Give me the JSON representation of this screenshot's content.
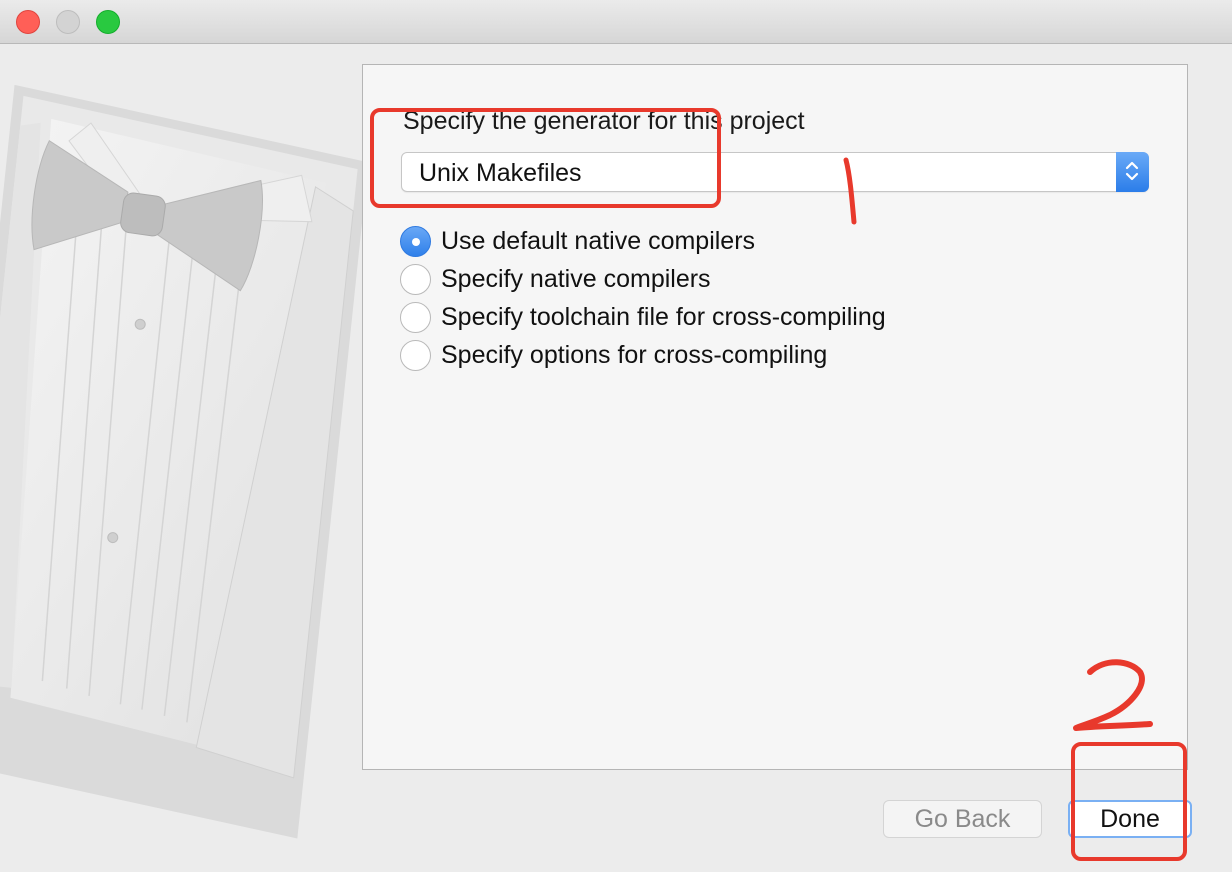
{
  "window": {
    "traffic_lights": [
      "close",
      "minimize",
      "zoom"
    ]
  },
  "generator": {
    "label": "Specify the generator for this project",
    "selected": "Unix Makefiles"
  },
  "compiler_options": [
    {
      "label": "Use default native compilers",
      "selected": true
    },
    {
      "label": "Specify native compilers",
      "selected": false
    },
    {
      "label": "Specify toolchain file for cross-compiling",
      "selected": false
    },
    {
      "label": "Specify options for cross-compiling",
      "selected": false
    }
  ],
  "buttons": {
    "back": "Go Back",
    "done": "Done"
  },
  "colors": {
    "accent": "#2f80ea",
    "annotation": "#e8392c"
  },
  "annotations": [
    {
      "number": "1",
      "target": "generator"
    },
    {
      "number": "2",
      "target": "done-button"
    }
  ]
}
